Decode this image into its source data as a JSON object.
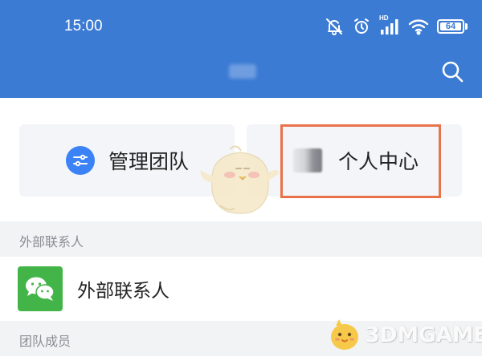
{
  "status_bar": {
    "time": "15:00",
    "icons": [
      "bell-muted-icon",
      "alarm-icon",
      "hd-signal-icon",
      "wifi-icon",
      "battery-icon"
    ],
    "hd_label": "HD",
    "battery_level": "64"
  },
  "header": {
    "search_icon": "search-icon",
    "accent_color": "#3b7bd4"
  },
  "cards": {
    "manage_team": {
      "label": "管理团队",
      "icon": "sliders-icon",
      "icon_color": "#3b82f6"
    },
    "personal_center": {
      "label": "个人中心",
      "icon": "avatar-icon"
    }
  },
  "highlight_color": "#e8734a",
  "sections": {
    "external_contacts_header": "外部联系人",
    "team_members_header": "团队成员"
  },
  "list": {
    "external_contacts": {
      "label": "外部联系人",
      "icon": "wechat-icon",
      "icon_color": "#43b548"
    }
  },
  "watermark": {
    "text": "3DMGAME"
  }
}
